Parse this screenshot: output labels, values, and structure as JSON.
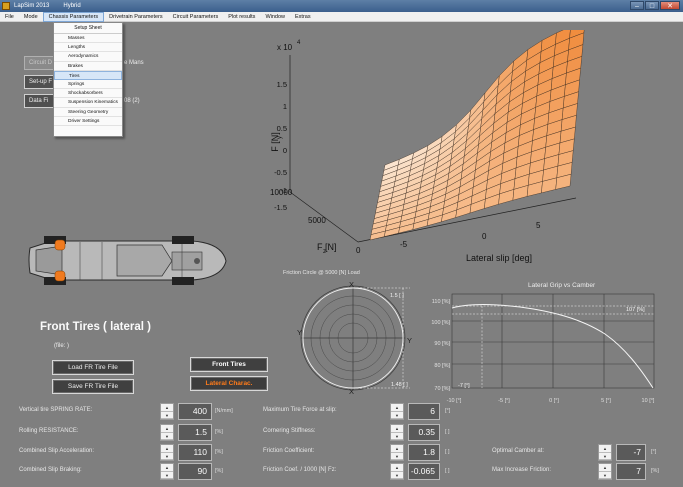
{
  "window": {
    "title": "LapSim 2013",
    "subtitle": "Hybrid",
    "minimize": "–",
    "maximize": "□",
    "close": "✕"
  },
  "menu": [
    "File",
    "Mode",
    "Chassis Parameters",
    "Drivetrain Parameters",
    "Circuit Parameters",
    "Plot results",
    "Window",
    "Extras"
  ],
  "dropdown": {
    "header": "Setup Sheet",
    "items": [
      "Masses",
      "Lengths",
      "Aerodynamics",
      "Brakes",
      "Tires",
      "Springs",
      "Shockabsorbers",
      "Suspension Kinematics",
      "Steering Geometry",
      "Driver Settings"
    ],
    "highlighted": "Tires"
  },
  "left_panel": {
    "btn1": "Circuit D",
    "btn1_suffix": "e Mans",
    "btn2": "Set-up F",
    "btn3": "Data Fi",
    "btn3_suffix": "08 (2)"
  },
  "plot3d": {
    "exponent": "x 10",
    "exponent_power": "4",
    "z_ticks": [
      "1.5",
      "1",
      "0.5",
      "0",
      "-0.5",
      "-1",
      "-1.5"
    ],
    "z_label": "F [N]",
    "z_label_sub": "y",
    "fz_ticks": [
      "10000",
      "5000",
      "0"
    ],
    "fz_label": "F [N]",
    "fz_label_sub": "z",
    "slip_ticks": [
      "-5",
      "0",
      "5"
    ],
    "slip_label": "Lateral slip [deg]",
    "colors": {
      "light": "#fbe7d3",
      "dark": "#f08a3a",
      "grid": "#3a2b20"
    }
  },
  "tires": {
    "title": "Front Tires ( lateral )",
    "file_label": "(file:   )",
    "load_btn": "Load FR Tire File",
    "save_btn": "Save FR Tire File",
    "front_btn": "Front Tires",
    "lateral_btn": "Lateral Charac."
  },
  "friction_circle": {
    "title": "Friction Circle @ 5000 [N] Load",
    "x_top": "X",
    "x_bottom": "X",
    "y_left": "Y",
    "y_right": "Y",
    "val_top": "1.5 [ ]",
    "val_bottom": "1.48 [ ]"
  },
  "lateral_grip": {
    "title": "Lateral Grip vs Camber",
    "y_ticks": [
      "110 [%]",
      "100 [%]",
      "90 [%]",
      "80 [%]",
      "70 [%]"
    ],
    "x_ticks": [
      "-10 [°]",
      "-5 [°]",
      "0 [°]",
      "5 [°]",
      "10 [°]"
    ],
    "max_label": "107 [%]",
    "camber_label": "-7 [°]"
  },
  "params_left": [
    {
      "label": "Vertical tire SPRING RATE:",
      "value": "400",
      "unit": "[N/mm]"
    },
    {
      "label": "Rolling RESISTANCE:",
      "value": "1.5",
      "unit": "[%]"
    },
    {
      "label": "Combined Slip Acceleration:",
      "value": "110",
      "unit": "[%]"
    },
    {
      "label": "Combined Slip Braking:",
      "value": "90",
      "unit": "[%]"
    }
  ],
  "params_mid": [
    {
      "label": "Maximum Tire Force at slip:",
      "value": "6",
      "unit": "[°]"
    },
    {
      "label": "Cornering Stiffness:",
      "value": "0.35",
      "unit": "[ ]"
    },
    {
      "label": "Friction Coefficient:",
      "value": "1.8",
      "unit": "[ ]"
    },
    {
      "label": "Friction Coef. / 1000 [N] Fz:",
      "value": "-0.065",
      "unit": "[ ]"
    }
  ],
  "params_right": [
    {
      "label": "Optimal Camber at:",
      "value": "-7",
      "unit": "[°]"
    },
    {
      "label": "Max Increase Friction:",
      "value": "7",
      "unit": "[%]"
    }
  ]
}
